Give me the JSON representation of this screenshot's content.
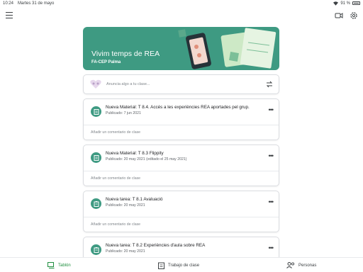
{
  "status_bar": {
    "time": "10:24",
    "date": "Martes 31 de mayo",
    "battery": "91 %"
  },
  "icons": {
    "menu": "menu-icon",
    "meet": "video-camera-icon",
    "settings": "gear-icon",
    "announce": "people-heart-icon",
    "repost": "repost-icon",
    "material": "material-icon",
    "assignment": "assignment-icon",
    "more": "more-icon",
    "stream": "stream-icon",
    "classwork": "classwork-icon",
    "people": "people-icon"
  },
  "colors": {
    "banner": "#3e9a82",
    "accent": "#1e8e3e"
  },
  "banner": {
    "title": "Vivim temps de REA",
    "subtitle": "FA-CEP Palma"
  },
  "announce": {
    "placeholder": "Anuncia algo a tu clase..."
  },
  "posts": [
    {
      "type": "material",
      "title": "Nueva Material: T 8.4. Accés a les experiències REA aportades pel grup.",
      "date": "Publicado: 7 jun 2021",
      "comment": "Añadir un comentario de clase"
    },
    {
      "type": "material",
      "title": "Nueva Material: T 8.3 Flippity",
      "date": "Publicado: 20 may 2021 (editado el 25 may 2021)",
      "comment": "Añadir un comentario de clase"
    },
    {
      "type": "assignment",
      "title": "Nueva tarea: T 8.1 Avaluació",
      "date": "Publicado: 20 may 2021",
      "comment": "Añadir un comentario de clase"
    },
    {
      "type": "assignment",
      "title": "Nueva tarea: T 8.2 Experiències d'aula sobre REA",
      "date": "Publicado: 20 may 2021"
    }
  ],
  "bottom_nav": {
    "stream": "Tablón",
    "classwork": "Trabajo de clase",
    "people": "Personas"
  }
}
